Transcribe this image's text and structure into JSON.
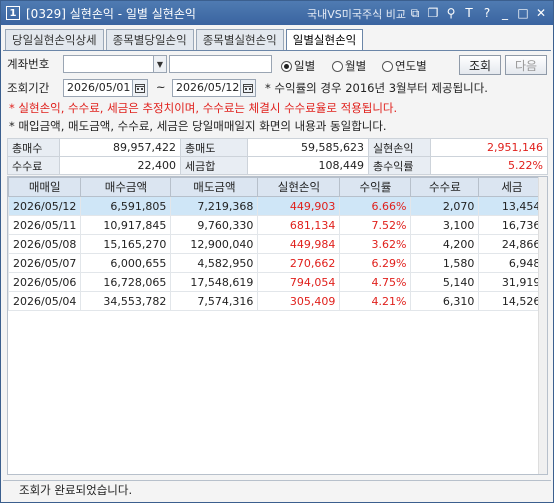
{
  "title": {
    "number": "1",
    "code": "[0329]",
    "text": "실현손익 - 일별 실현손익",
    "compare_link": "국내VS미국주식 비교",
    "icons": [
      "window-icon",
      "copy-icon",
      "pin-icon",
      "font-icon",
      "help-icon",
      "minimize-icon",
      "maximize-icon",
      "close-icon"
    ],
    "glyphs": [
      "⧉",
      "❐",
      "⚲",
      "T",
      "?",
      "_",
      "□",
      "✕"
    ]
  },
  "tabs": [
    {
      "label": "당일실현손익상세",
      "active": false
    },
    {
      "label": "종목별당일손익",
      "active": false
    },
    {
      "label": "종목별실현손익",
      "active": false
    },
    {
      "label": "일별실현손익",
      "active": true
    }
  ],
  "form": {
    "account_label": "계좌번호",
    "account_value": "",
    "account_name": "",
    "period_label": "조회기간",
    "date_from": "2026/05/01",
    "date_to": "2026/05/12",
    "tilde": "~",
    "radios": [
      {
        "label": "일별",
        "checked": true
      },
      {
        "label": "월별",
        "checked": false
      },
      {
        "label": "연도별",
        "checked": false
      }
    ],
    "search_btn": "조회",
    "next_btn": "다음",
    "info_note": "* 수익률의 경우 2016년 3월부터 제공됩니다."
  },
  "notes": {
    "red": "* 실현손익, 수수료, 세금은 추정치이며, 수수료는 체결시 수수료율로 적용됩니다.",
    "black": "* 매입금액, 매도금액, 수수료, 세금은 당일매매일지 화면의 내용과 동일합니다."
  },
  "summary": {
    "total_buy_label": "총매수",
    "total_buy": "89,957,422",
    "total_sell_label": "총매도",
    "total_sell": "59,585,623",
    "realized_label": "실현손익",
    "realized": "2,951,146",
    "fee_label": "수수료",
    "fee": "22,400",
    "tax_label": "세금합",
    "tax": "108,449",
    "return_label": "총수익률",
    "return": "5.22%"
  },
  "grid": {
    "headers": [
      "매매일",
      "매수금액",
      "매도금액",
      "실현손익",
      "수익률",
      "수수료",
      "세금"
    ],
    "rows": [
      [
        "2026/05/12",
        "6,591,805",
        "7,219,368",
        "449,903",
        "6.66%",
        "2,070",
        "13,454"
      ],
      [
        "2026/05/11",
        "10,917,845",
        "9,760,330",
        "681,134",
        "7.52%",
        "3,100",
        "16,736"
      ],
      [
        "2026/05/08",
        "15,165,270",
        "12,900,040",
        "449,984",
        "3.62%",
        "4,200",
        "24,866"
      ],
      [
        "2026/05/07",
        "6,000,655",
        "4,582,950",
        "270,662",
        "6.29%",
        "1,580",
        "6,948"
      ],
      [
        "2026/05/06",
        "16,728,065",
        "17,548,619",
        "794,054",
        "4.75%",
        "5,140",
        "31,919"
      ],
      [
        "2026/05/04",
        "34,553,782",
        "7,574,316",
        "305,409",
        "4.21%",
        "6,310",
        "14,526"
      ]
    ]
  },
  "status": "조회가 완료되었습니다.",
  "colors": {
    "profit": "#e0201c",
    "titlebar": "#3a64a0",
    "header": "#dbe5f1",
    "selected": "#cfe6f7"
  }
}
